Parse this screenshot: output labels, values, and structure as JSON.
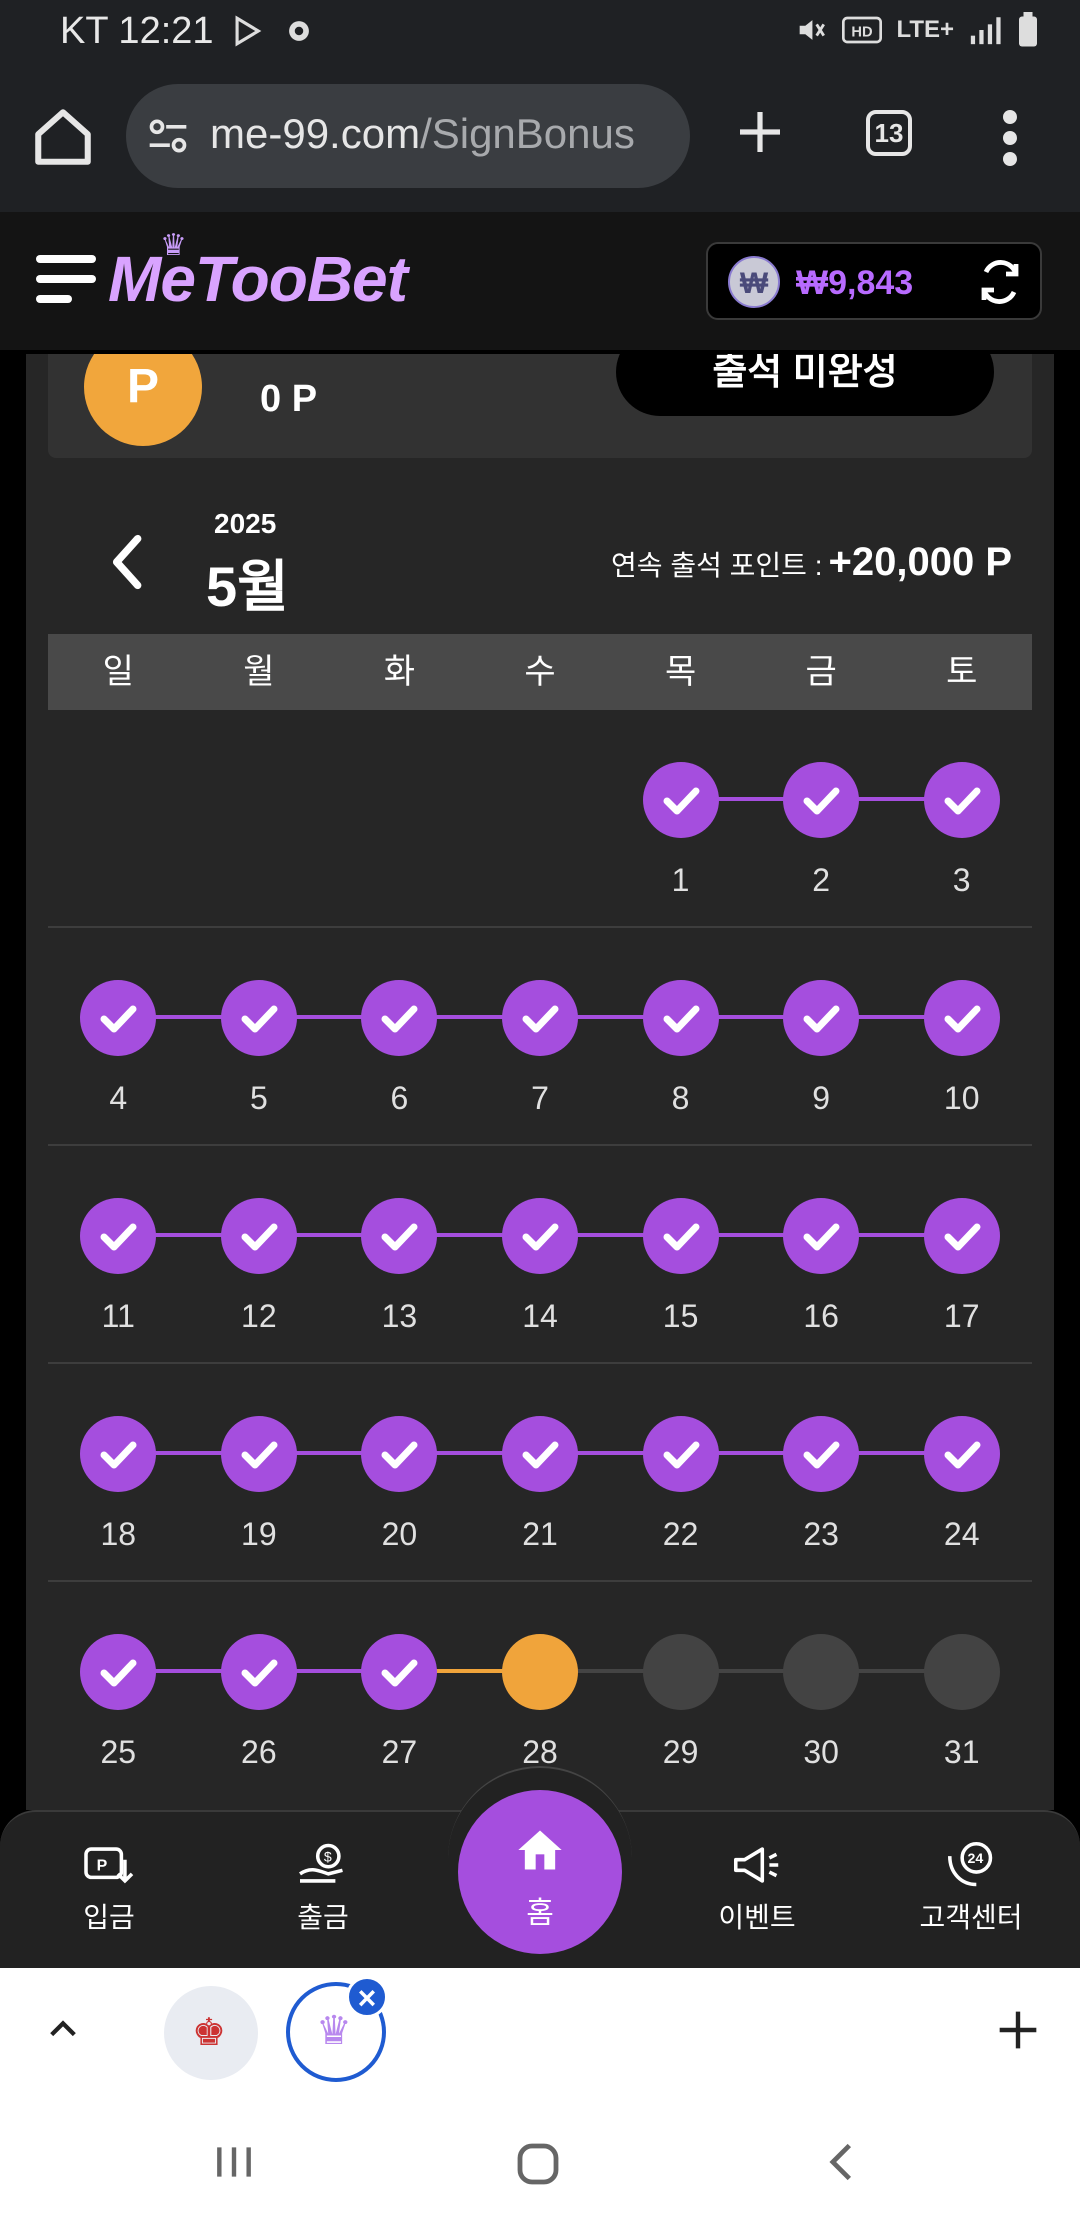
{
  "status_bar": {
    "carrier_time": "KT 12:21",
    "network": "LTE+"
  },
  "browser": {
    "url_domain": "me-99.com",
    "url_path": "/SignBonus",
    "tab_count": "13"
  },
  "site": {
    "logo_text": "MeTooBet",
    "balance": "₩9,843",
    "coin_symbol": "₩"
  },
  "points_card": {
    "badge": "P",
    "points": "0 P",
    "attendance_button": "출석 미완성"
  },
  "calendar": {
    "year": "2025",
    "month": "5월",
    "streak_label": "연속 출석 포인트 :",
    "streak_value": "+20,000 P",
    "weekdays": [
      "일",
      "월",
      "화",
      "수",
      "목",
      "금",
      "토"
    ],
    "weeks": [
      [
        "",
        "",
        "",
        "",
        "1",
        "2",
        "3"
      ],
      [
        "4",
        "5",
        "6",
        "7",
        "8",
        "9",
        "10"
      ],
      [
        "11",
        "12",
        "13",
        "14",
        "15",
        "16",
        "17"
      ],
      [
        "18",
        "19",
        "20",
        "21",
        "22",
        "23",
        "24"
      ],
      [
        "25",
        "26",
        "27",
        "28",
        "29",
        "30",
        "31"
      ]
    ],
    "status": {
      "done": [
        "1",
        "2",
        "3",
        "4",
        "5",
        "6",
        "7",
        "8",
        "9",
        "10",
        "11",
        "12",
        "13",
        "14",
        "15",
        "16",
        "17",
        "18",
        "19",
        "20",
        "21",
        "22",
        "23",
        "24",
        "25",
        "26",
        "27"
      ],
      "today": "28",
      "pending": [
        "29",
        "30",
        "31"
      ]
    },
    "colors": {
      "done": "#a54ede",
      "today": "#f0a43b",
      "pending": "#434343"
    }
  },
  "bottom_nav": {
    "deposit": "입금",
    "withdraw": "출금",
    "home": "홈",
    "event": "이벤트",
    "support": "고객센터"
  }
}
